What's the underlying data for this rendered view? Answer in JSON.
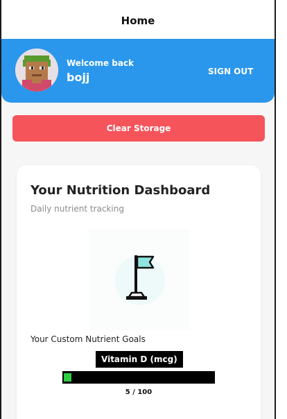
{
  "nav": {
    "title": "Home"
  },
  "header": {
    "welcome": "Welcome back",
    "username": "bojj",
    "signout_label": "SIGN OUT",
    "avatar_icon": "pixel-avatar-icon"
  },
  "actions": {
    "clear_storage_label": "Clear Storage"
  },
  "dashboard": {
    "title": "Your Nutrition Dashboard",
    "subtitle": "Daily nutrient tracking",
    "illustration_icon": "flag-icon",
    "goals_label": "Your Custom Nutrient Goals",
    "goal": {
      "name": "Vitamin D (mcg)",
      "current": 5,
      "target": 100,
      "progress_text": "5 / 100",
      "progress_fraction": 0.05
    }
  },
  "colors": {
    "header_blue": "#2a97ec",
    "clear_button_red": "#f5545b",
    "progress_green": "#2ecc40",
    "flag_teal": "#8fe3de"
  }
}
